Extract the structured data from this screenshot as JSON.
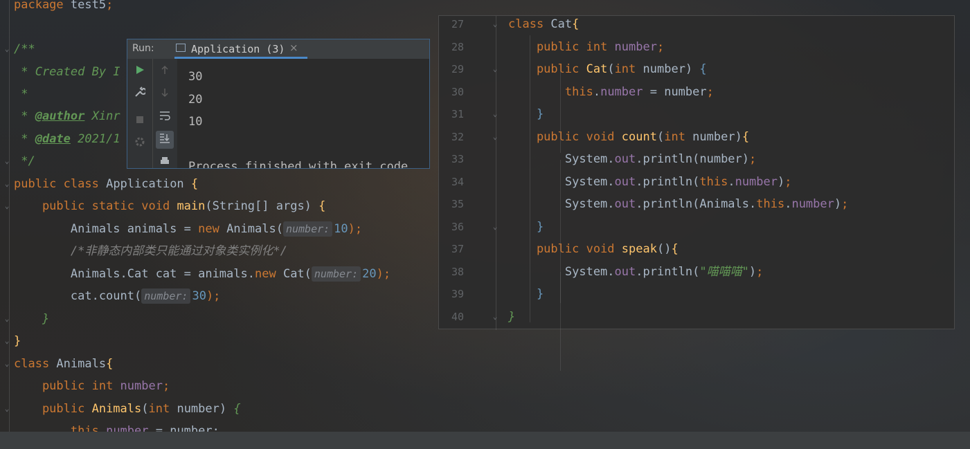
{
  "editor": {
    "lines": [
      {
        "segs": [
          [
            "package ",
            "kw"
          ],
          [
            "test5",
            ""
          ],
          [
            ";",
            "kw"
          ]
        ]
      },
      {
        "segs": []
      },
      {
        "segs": [
          [
            "/**",
            "cm"
          ]
        ]
      },
      {
        "segs": [
          [
            " * Created By I",
            "cm"
          ]
        ]
      },
      {
        "segs": [
          [
            " *",
            "cm"
          ]
        ]
      },
      {
        "segs": [
          [
            " * ",
            "cm"
          ],
          [
            "@author",
            "tag"
          ],
          [
            " Xinr",
            "cm"
          ]
        ]
      },
      {
        "segs": [
          [
            " * ",
            "cm"
          ],
          [
            "@date",
            "tag"
          ],
          [
            " 2021/1",
            "cm"
          ]
        ]
      },
      {
        "segs": [
          [
            " */",
            "cm"
          ]
        ]
      },
      {
        "segs": [
          [
            "public ",
            "kw"
          ],
          [
            "class ",
            "kw"
          ],
          [
            "Application ",
            ""
          ],
          [
            "{",
            "fn"
          ]
        ]
      },
      {
        "segs": [
          [
            "    public ",
            "kw"
          ],
          [
            "static ",
            "kw"
          ],
          [
            "void ",
            "kw"
          ],
          [
            "main",
            "fn"
          ],
          [
            "(String[] args) ",
            ""
          ],
          [
            "{",
            "fn"
          ]
        ]
      },
      {
        "segs": [
          [
            "        Animals animals = ",
            ""
          ],
          [
            "new ",
            "kw"
          ],
          [
            "Animals(",
            ""
          ],
          [
            "number:",
            "hint"
          ],
          [
            "10",
            "num"
          ],
          [
            ");",
            "kw"
          ]
        ]
      },
      {
        "segs": [
          [
            "        /*非静态内部类只能通过对象类实例化*/",
            "cmt"
          ]
        ]
      },
      {
        "segs": [
          [
            "        Animals.Cat cat = animals.",
            ""
          ],
          [
            "new ",
            "kw"
          ],
          [
            "Cat(",
            ""
          ],
          [
            "number:",
            "hint"
          ],
          [
            "20",
            "num"
          ],
          [
            ");",
            "kw"
          ]
        ]
      },
      {
        "segs": [
          [
            "        cat.count(",
            ""
          ],
          [
            "number:",
            "hint"
          ],
          [
            "30",
            "num"
          ],
          [
            ");",
            "kw"
          ]
        ]
      },
      {
        "segs": [
          [
            "    }",
            "cm"
          ]
        ]
      },
      {
        "segs": [
          [
            "}",
            "fn"
          ]
        ]
      },
      {
        "segs": [
          [
            "class ",
            "kw"
          ],
          [
            "Animals",
            ""
          ],
          [
            "{",
            "fn"
          ]
        ]
      },
      {
        "segs": [
          [
            "    public ",
            "kw"
          ],
          [
            "int ",
            "kw"
          ],
          [
            "number",
            "fld"
          ],
          [
            ";",
            "kw"
          ]
        ]
      },
      {
        "segs": [
          [
            "    public ",
            "kw"
          ],
          [
            "Animals",
            "fn"
          ],
          [
            "(",
            ""
          ],
          [
            "int ",
            "kw"
          ],
          [
            "number) ",
            ""
          ],
          [
            "{",
            "cm"
          ]
        ]
      },
      {
        "segs": [
          [
            "        this",
            "kw"
          ],
          [
            ".",
            ""
          ],
          [
            "number",
            "fld"
          ],
          [
            " = number;",
            ""
          ]
        ]
      }
    ]
  },
  "run_panel": {
    "title": "Run:",
    "tab_label": "Application (3)",
    "tab_close": "×",
    "output": [
      "30",
      "20",
      "10",
      "",
      "Process finished with exit code"
    ]
  },
  "peek": {
    "line_numbers": [
      "27",
      "28",
      "29",
      "30",
      "31",
      "32",
      "33",
      "34",
      "35",
      "36",
      "37",
      "38",
      "39",
      "40"
    ],
    "lines": [
      {
        "segs": [
          [
            "class ",
            "kw"
          ],
          [
            "Cat",
            ""
          ],
          [
            "{",
            "fn"
          ]
        ]
      },
      {
        "segs": [
          [
            "    public ",
            "kw"
          ],
          [
            "int ",
            "kw"
          ],
          [
            "number",
            "fld"
          ],
          [
            ";",
            "kw"
          ]
        ]
      },
      {
        "segs": [
          [
            "    public ",
            "kw"
          ],
          [
            "Cat",
            "fn"
          ],
          [
            "(",
            ""
          ],
          [
            "int ",
            "kw"
          ],
          [
            "number) ",
            ""
          ],
          [
            "{",
            "num"
          ]
        ]
      },
      {
        "segs": [
          [
            "        this",
            "kw"
          ],
          [
            ".",
            ""
          ],
          [
            "number",
            "fld"
          ],
          [
            " = number",
            ""
          ],
          [
            ";",
            "kw"
          ]
        ]
      },
      {
        "segs": [
          [
            "    }",
            "num"
          ]
        ]
      },
      {
        "segs": [
          [
            "    public ",
            "kw"
          ],
          [
            "void ",
            "kw"
          ],
          [
            "count",
            "fn"
          ],
          [
            "(",
            ""
          ],
          [
            "int ",
            "kw"
          ],
          [
            "number)",
            ""
          ],
          [
            "{",
            "fn"
          ]
        ]
      },
      {
        "segs": [
          [
            "        System.",
            ""
          ],
          [
            "out",
            "fld"
          ],
          [
            ".println(number)",
            ""
          ],
          [
            ";",
            "kw"
          ]
        ]
      },
      {
        "segs": [
          [
            "        System.",
            ""
          ],
          [
            "out",
            "fld"
          ],
          [
            ".println(",
            ""
          ],
          [
            "this",
            "kw"
          ],
          [
            ".",
            ""
          ],
          [
            "number",
            "fld"
          ],
          [
            ")",
            ""
          ],
          [
            ";",
            "kw"
          ]
        ]
      },
      {
        "segs": [
          [
            "        System.",
            ""
          ],
          [
            "out",
            "fld"
          ],
          [
            ".println(Animals.",
            ""
          ],
          [
            "this",
            "kw"
          ],
          [
            ".",
            ""
          ],
          [
            "number",
            "fld"
          ],
          [
            ")",
            ""
          ],
          [
            ";",
            "kw"
          ]
        ]
      },
      {
        "segs": [
          [
            "    }",
            "num"
          ]
        ]
      },
      {
        "segs": [
          [
            "    public ",
            "kw"
          ],
          [
            "void ",
            "kw"
          ],
          [
            "speak",
            "fn"
          ],
          [
            "()",
            ""
          ],
          [
            "{",
            "fn"
          ]
        ]
      },
      {
        "segs": [
          [
            "        System.",
            ""
          ],
          [
            "out",
            "fld"
          ],
          [
            ".println(",
            ""
          ],
          [
            "\"喵喵喵\"",
            "cm"
          ],
          [
            ")",
            ""
          ],
          [
            ";",
            "kw"
          ]
        ]
      },
      {
        "segs": [
          [
            "    }",
            "num"
          ]
        ]
      },
      {
        "segs": [
          [
            "}",
            "cm"
          ]
        ]
      }
    ]
  },
  "colors": {
    "keyword": "#cc7832",
    "function": "#ffc66d",
    "number": "#6897bb",
    "field": "#9876aa",
    "doc_comment": "#629755",
    "comment": "#808080"
  }
}
